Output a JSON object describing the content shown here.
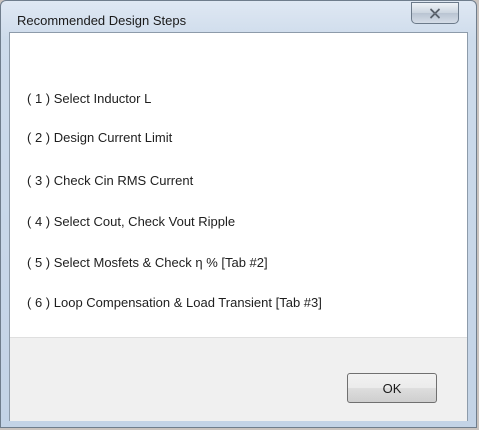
{
  "dialog": {
    "title": "Recommended Design Steps",
    "close_icon": "close-icon"
  },
  "steps": [
    {
      "number": "( 1 )",
      "text": "Select Inductor L"
    },
    {
      "number": "( 2 )",
      "text": "Design Current Limit"
    },
    {
      "number": "( 3 )",
      "text": "Check Cin RMS Current"
    },
    {
      "number": "( 4 )",
      "text": "Select Cout, Check Vout Ripple"
    },
    {
      "number": "( 5 )",
      "text": "Select Mosfets & Check η % [Tab #2]"
    },
    {
      "number": "( 6 )",
      "text": "Loop Compensation & Load Transient [Tab #3]"
    }
  ],
  "buttons": {
    "ok_label": "OK"
  }
}
